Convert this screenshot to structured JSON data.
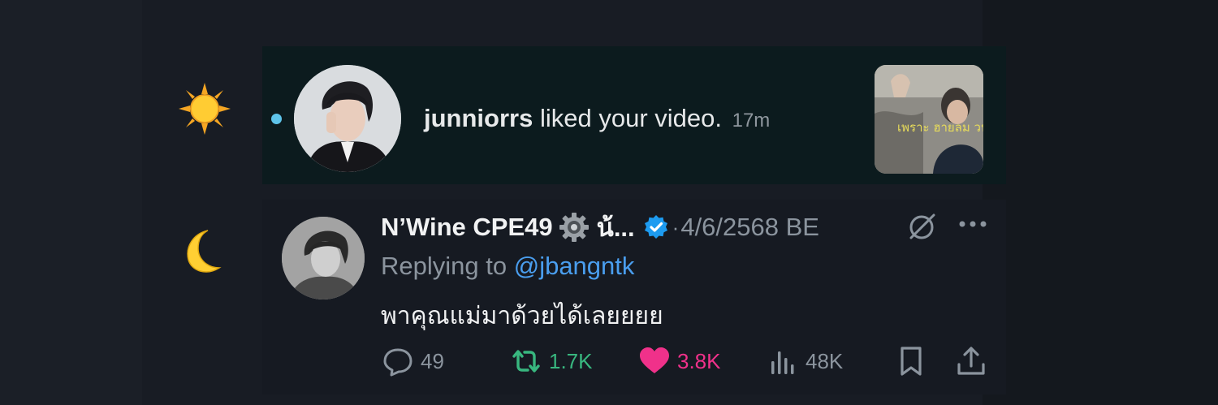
{
  "side": {
    "sun_icon": "sun-icon",
    "moon_icon": "crescent-moon-icon"
  },
  "notification": {
    "username": "junniorrs",
    "action_text": "liked your video.",
    "time": "17m",
    "thumbnail_text": "เพราะ ฮายลม วนนี้",
    "colors": {
      "background": "#0c1b1e",
      "unread_dot": "#5ec4ea"
    }
  },
  "tweet": {
    "display_name": "N’Wine CPE49",
    "name_suffix": "น้...",
    "separator": "·",
    "date": "4/6/2568 BE",
    "replying_prefix": "Replying to",
    "replying_handle": "@jbangntk",
    "body": "พาคุณแม่มาด้วยได้เลยยยย",
    "actions": {
      "replies": "49",
      "retweets": "1.7K",
      "likes": "3.8K",
      "views": "48K"
    },
    "colors": {
      "retweet": "#38b77f",
      "like": "#f0318a",
      "link": "#4a9eef",
      "verified": "#1d9bf0",
      "muted": "#8b949e"
    }
  }
}
